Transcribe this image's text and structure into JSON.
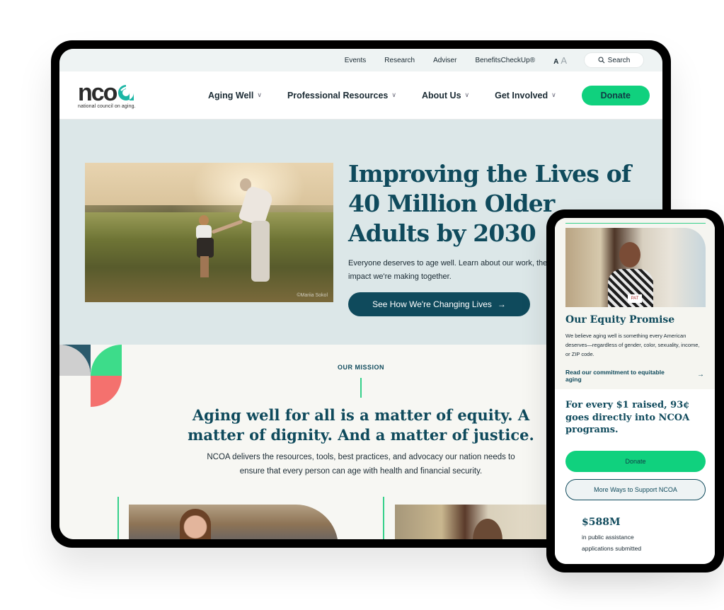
{
  "utility_bar": {
    "links": [
      "Events",
      "Research",
      "Adviser",
      "BenefitsCheckUp®"
    ],
    "font_size_small": "A",
    "font_size_large": "A",
    "search_label": "Search"
  },
  "logo": {
    "wordmark": "ncoa",
    "tagline": "national council on aging."
  },
  "nav": {
    "items": [
      {
        "label": "Aging Well"
      },
      {
        "label": "Professional Resources"
      },
      {
        "label": "About Us"
      },
      {
        "label": "Get Involved"
      }
    ],
    "donate_label": "Donate"
  },
  "hero": {
    "title_lines": [
      "Improving the Lives of",
      "40 Million Older",
      "Adults by 2030"
    ],
    "description": "Everyone deserves to age well. Learn about our work, the people we serve, and the impact we're making together.",
    "description_visible_line1": "Everyone deserves to age well. Learn about our work, the p",
    "description_visible_line2": "impact we're making together.",
    "cta_label": "See How We're Changing Lives",
    "cta_arrow": "→",
    "photo_credit": "©Mariia Sokol"
  },
  "mission": {
    "eyebrow": "OUR MISSION",
    "title_lines": [
      "Aging well for all is a matter of equity. A",
      "matter of dignity. And a matter of justice."
    ],
    "description_lines": [
      "NCOA delivers the resources, tools, best practices, and advocacy our nation needs to",
      "ensure that every person can age with health and financial security."
    ]
  },
  "phone": {
    "equity": {
      "photo_tag": "PAT",
      "title": "Our Equity Promise",
      "description": "We believe aging well is something every American deserves—regardless of gender, color, sexuality, income, or ZIP code.",
      "link_label": "Read our commitment to equitable aging",
      "link_arrow": "→"
    },
    "support": {
      "title": "For every $1 raised, 93¢ goes directly into NCOA programs.",
      "donate_label": "Donate",
      "more_label": "More Ways to Support NCOA"
    },
    "stat": {
      "value": "$588M",
      "label_lines": [
        "in public assistance",
        "applications submitted"
      ]
    }
  },
  "colors": {
    "brand_teal": "#0f4a5c",
    "accent_green": "#10d17e",
    "hero_bg": "#dce7e8",
    "coral": "#f4716e",
    "light_grey": "#cfcfcf"
  }
}
